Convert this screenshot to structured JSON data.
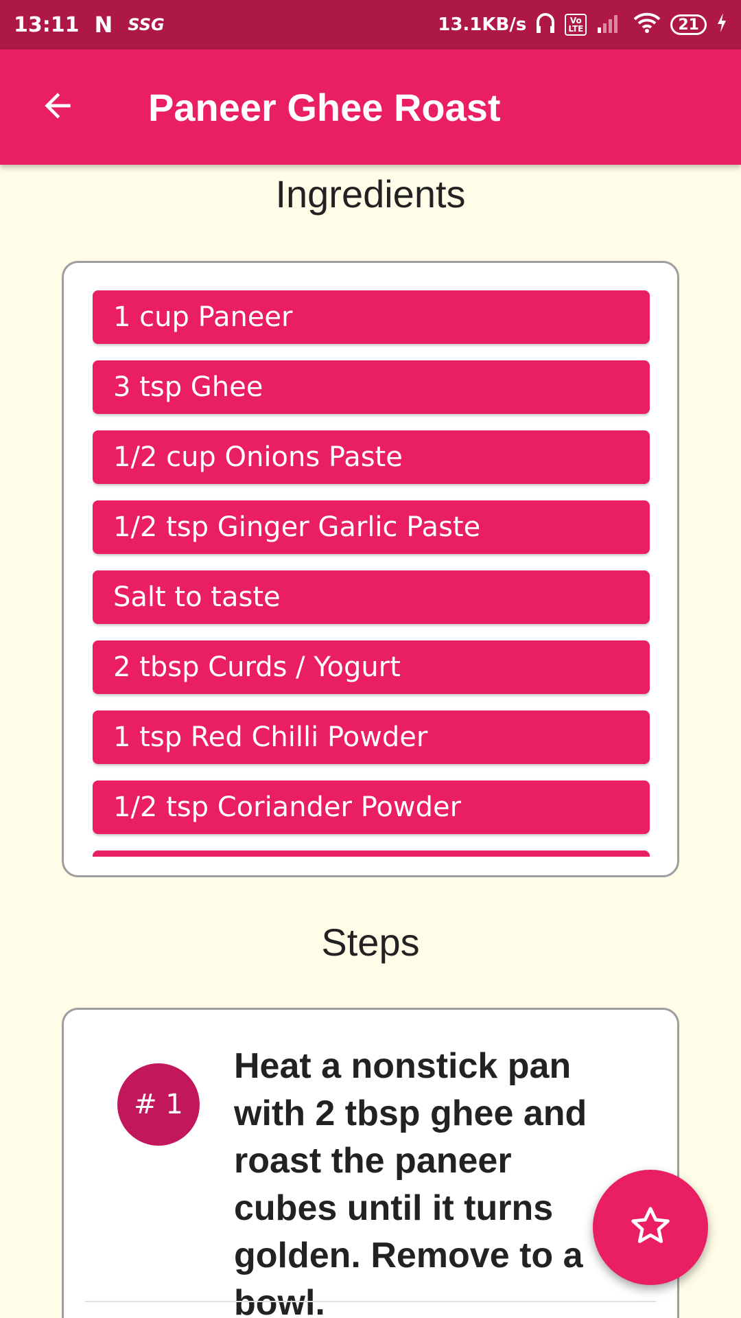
{
  "status_bar": {
    "time": "13:11",
    "network_badge": "SSG",
    "speed": "13.1KB/s",
    "volte_label": "Vo\nLTE",
    "battery": "21"
  },
  "app_bar": {
    "title": "Paneer Ghee Roast"
  },
  "ingredients": {
    "heading": "Ingredients",
    "items": [
      "1 cup Paneer",
      "3 tsp Ghee",
      "1/2 cup Onions Paste",
      "1/2 tsp Ginger Garlic Paste",
      "Salt to taste",
      "2 tbsp Curds / Yogurt",
      "1 tsp Red Chilli Powder",
      "1/2 tsp Coriander Powder",
      ""
    ]
  },
  "steps": {
    "heading": "Steps",
    "items": [
      {
        "number": "# 1",
        "text": "Heat a nonstick pan with 2 tbsp ghee and roast the paneer cubes until it turns golden. Remove to a bowl."
      }
    ]
  },
  "colors": {
    "primary": "#E91E63",
    "primary_dark": "#AD1846",
    "background": "#FFFDE7"
  },
  "icons": {
    "back": "arrow-left-icon",
    "fab": "star-outline-icon"
  }
}
